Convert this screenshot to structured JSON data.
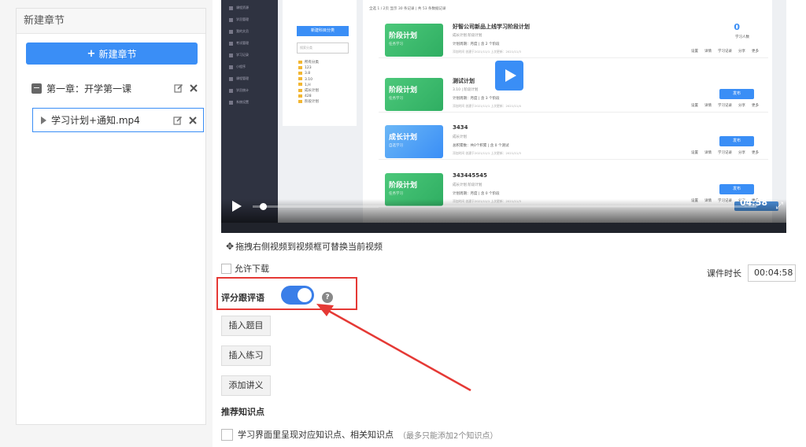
{
  "left_panel": {
    "title": "新建章节",
    "new_chapter_button": "新建章节",
    "chapter_label": "第一章：开学第一课",
    "lesson_label": "学习计划+通知.mp4"
  },
  "video": {
    "duration_display": "04:58",
    "progress": 0.02,
    "app_nav": [
      "课程资源",
      "学员管理",
      "我的文员",
      "考试管理",
      "学习记录",
      "小程序",
      "课程管理",
      "学员统计",
      "系统设置"
    ],
    "tree_button": "新建科目分类",
    "tree_search_placeholder": "搜索分类",
    "tree_items": [
      "所有分类",
      "123",
      "3.8",
      "3.10",
      "1,H",
      "成长计划",
      "428",
      "阶段计划"
    ],
    "toolbar_text": "全选   1   / 2页  显示  30   条记录 | 共 53 条数据记录",
    "cards": [
      {
        "thumb": "阶段计划",
        "thumb_sub": "任务学习",
        "title": "好智公司新品上线学习阶段计划",
        "sub": "成长计划  阶段计划",
        "meta": "计划周期：月度 | 含 2 个阶段",
        "date": "添加时间 创建于2021/11/1  上次更新：2021/11/3",
        "count": "0",
        "count_label": "学习人数",
        "publish": ""
      },
      {
        "thumb": "阶段计划",
        "thumb_sub": "任务学习",
        "title": "测试计划",
        "sub": "3.10 | 阶段计划",
        "meta": "计划周期：月度 | 含 3 个阶段",
        "date": "添加时间 创建于2021/11/1  上次更新：2021/11/4",
        "count": "",
        "count_label": "",
        "publish": "发布"
      },
      {
        "thumb": "成长计划",
        "thumb_sub": "自选学习",
        "title": "3434",
        "sub": "成长计划",
        "meta": "总积累数：共0个积累 | 含 0 个测试",
        "date": "添加时间 创建于2021/11/1  上次更新：2021/11/3",
        "count": "",
        "count_label": "",
        "publish": "发布"
      },
      {
        "thumb": "阶段计划",
        "thumb_sub": "任务学习",
        "title": "343445545",
        "sub": "成长计划  阶段计划",
        "meta": "计划周期：月度 | 含 0 个阶段",
        "date": "添加时间 创建于2021/11/1  上次更新：2021/11/3",
        "count": "",
        "count_label": "",
        "publish": "发布"
      }
    ],
    "card_ops": [
      "设置",
      "详情",
      "学习记录",
      "分享",
      "更多"
    ],
    "chat_label": "在线咨询"
  },
  "drag_hint": "拖拽右侧视频到视频框可替换当前视频",
  "allow_download_label": "允许下载",
  "duration_field": {
    "label": "课件时长",
    "value": "00:04:58"
  },
  "score_follow": {
    "label": "评分跟评语",
    "enabled": true,
    "help": "?"
  },
  "buttons": {
    "insert_question": "插入题目",
    "insert_exercise": "插入练习",
    "add_handout": "添加讲义"
  },
  "recommend": {
    "title": "推荐知识点",
    "option_label": "学习界面里呈现对应知识点、相关知识点",
    "note": "（最多只能添加2个知识点）"
  },
  "colors": {
    "accent": "#3a8ef6",
    "highlight": "#e53935",
    "toggle_on": "#3a7ee8"
  }
}
